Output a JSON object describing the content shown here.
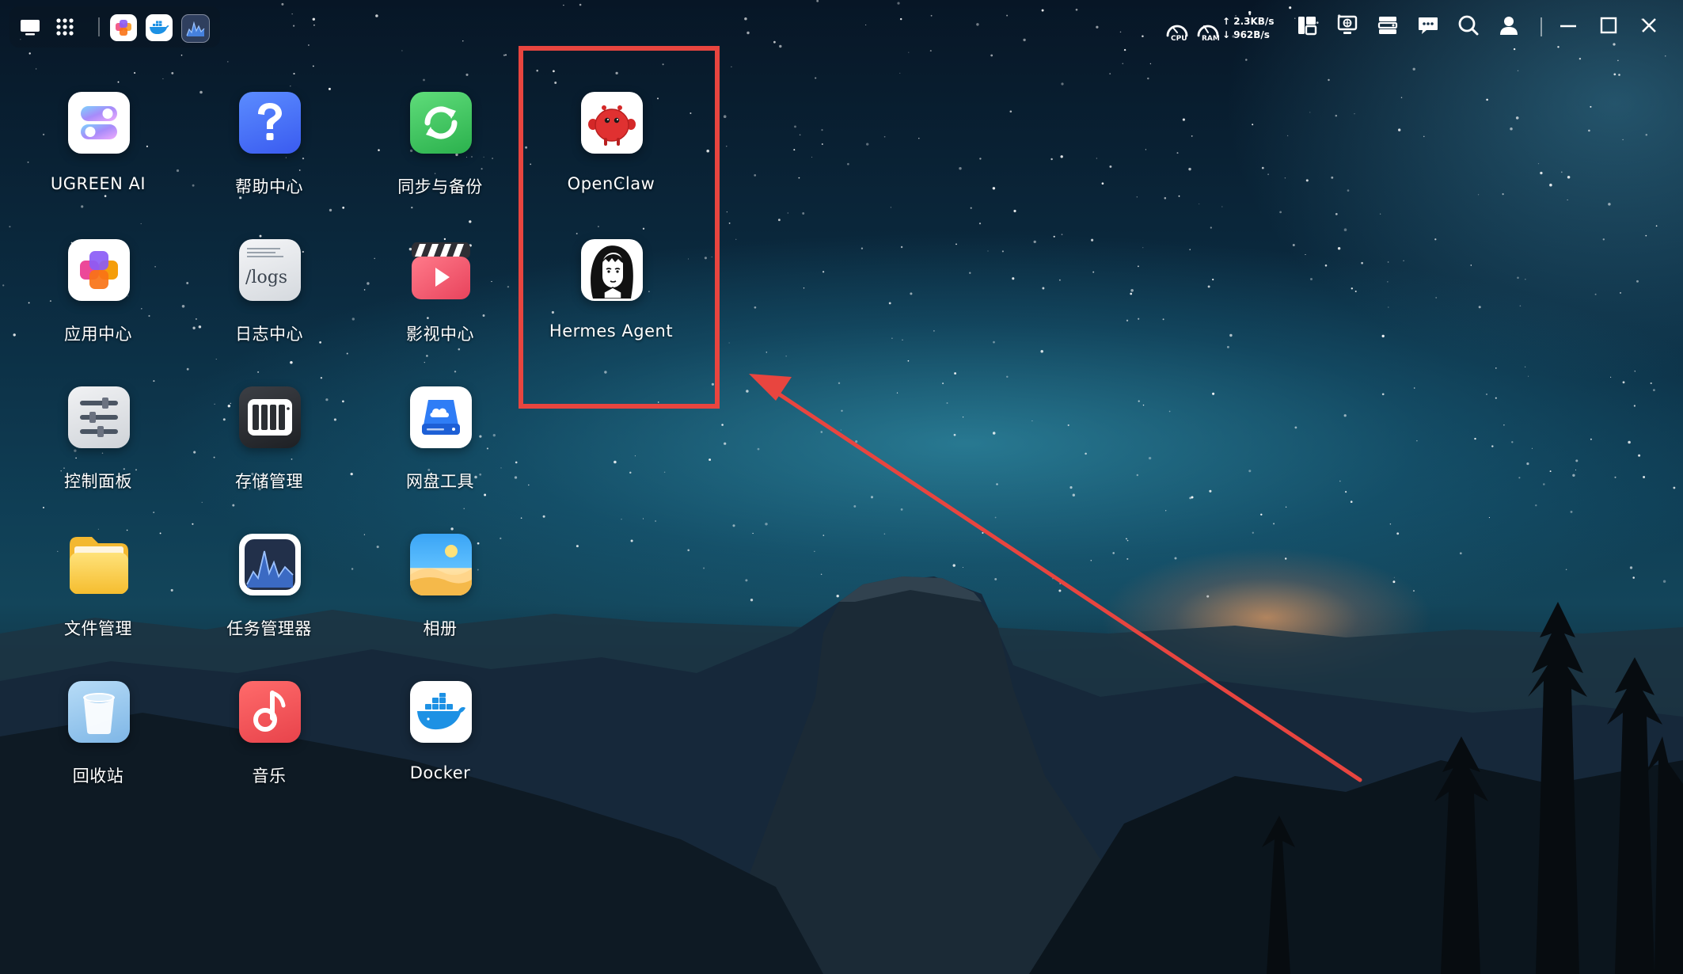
{
  "colors": {
    "annotation": "#e8453f",
    "text": "#ffffff"
  },
  "taskbar": {
    "show_desktop_icon": "desktop-icon",
    "app_grid_icon": "grid-icon",
    "pinned_apps": [
      "app-center-icon",
      "docker-icon",
      "task-manager-icon"
    ]
  },
  "system_tray": {
    "cpu_label": "CPU",
    "ram_label": "RAM",
    "upload_speed": "↑ 2.3KB/s",
    "download_speed": "↓ 962B/s",
    "icons": [
      "widgets-icon",
      "remote-desktop-icon",
      "server-icon",
      "chat-icon",
      "search-icon",
      "user-icon"
    ]
  },
  "window_controls": [
    "minimize-icon",
    "maximize-icon",
    "close-icon"
  ],
  "desktop": {
    "apps": [
      {
        "label": "UGREEN AI",
        "icon": "ugreen-ai-icon"
      },
      {
        "label": "帮助中心",
        "icon": "help-icon"
      },
      {
        "label": "同步与备份",
        "icon": "sync-icon"
      },
      {
        "label": "OpenClaw",
        "icon": "openclaw-icon"
      },
      {
        "label": "应用中心",
        "icon": "app-center-icon"
      },
      {
        "label": "日志中心",
        "icon": "logs-icon",
        "tile_text": "/logs"
      },
      {
        "label": "影视中心",
        "icon": "video-icon"
      },
      {
        "label": "Hermes Agent",
        "icon": "hermes-agent-icon"
      },
      {
        "label": "控制面板",
        "icon": "control-panel-icon"
      },
      {
        "label": "存储管理",
        "icon": "storage-icon"
      },
      {
        "label": "网盘工具",
        "icon": "cloud-drive-icon"
      },
      {
        "label": "文件管理",
        "icon": "folder-icon"
      },
      {
        "label": "任务管理器",
        "icon": "task-manager-icon"
      },
      {
        "label": "相册",
        "icon": "photos-icon"
      },
      {
        "label": "回收站",
        "icon": "recycle-bin-icon"
      },
      {
        "label": "音乐",
        "icon": "music-icon"
      },
      {
        "label": "Docker",
        "icon": "docker-icon"
      }
    ]
  }
}
